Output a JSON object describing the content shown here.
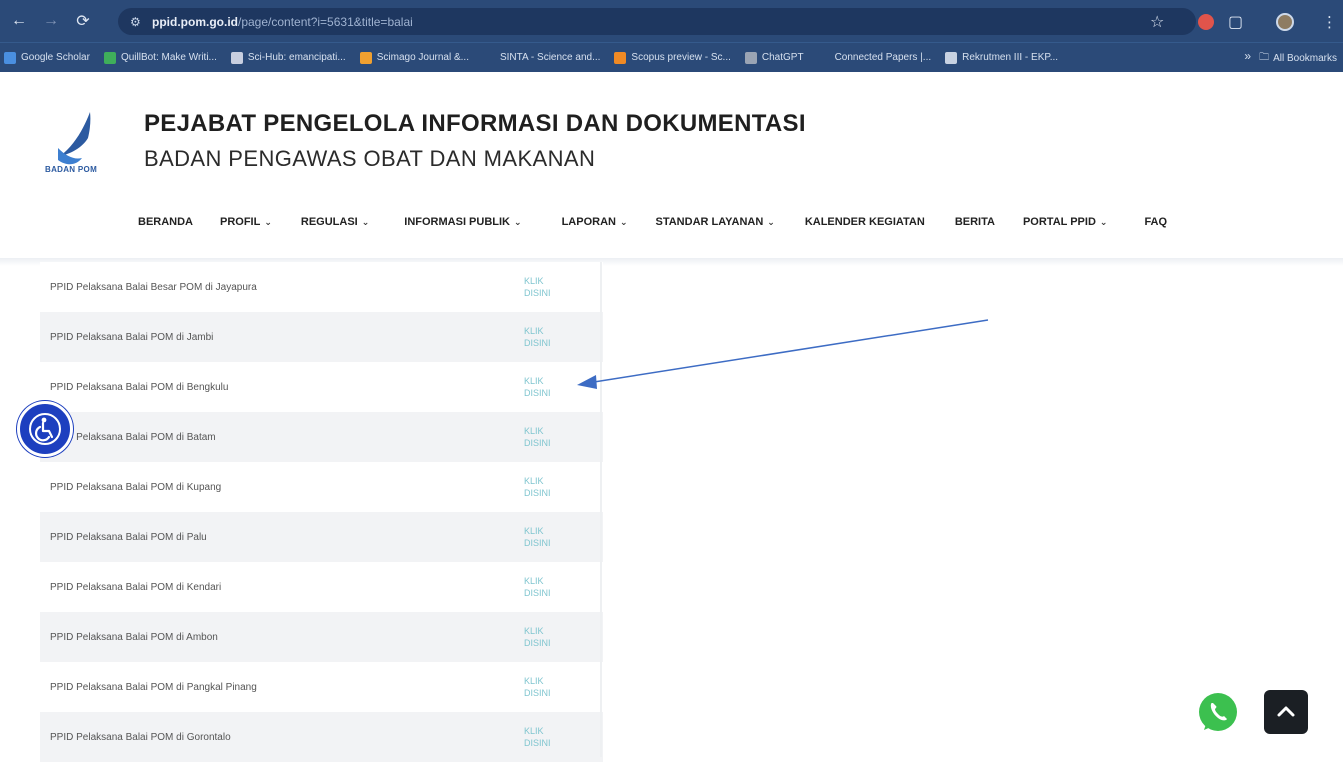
{
  "browser": {
    "url_host": "ppid.pom.go.id",
    "url_path": "/page/content?i=5631&title=balai",
    "bookmarks": [
      {
        "label": "Google Scholar",
        "color": "#4a8fe0"
      },
      {
        "label": "QuillBot: Make Writi...",
        "color": "#3fae5a"
      },
      {
        "label": "Sci-Hub: emancipati...",
        "color": "#c8cfe0"
      },
      {
        "label": "Scimago Journal &...",
        "color": "#f0a030"
      },
      {
        "label": "SINTA - Science and...",
        "color": "#2b4a78"
      },
      {
        "label": "Scopus preview - Sc...",
        "color": "#f08a24"
      },
      {
        "label": "ChatGPT",
        "color": "#9aa4b4"
      },
      {
        "label": "Connected Papers |...",
        "color": "#2b4a78"
      },
      {
        "label": "Rekrutmen III - EKP...",
        "color": "#c8d2e2"
      }
    ],
    "overflow_label": "»",
    "all_bookmarks": "All Bookmarks"
  },
  "site": {
    "logo_text": "BADAN POM",
    "title": "PEJABAT PENGELOLA INFORMASI DAN DOKUMENTASI",
    "subtitle": "BADAN PENGAWAS OBAT DAN MAKANAN"
  },
  "nav": [
    {
      "label": "BERANDA",
      "dropdown": false
    },
    {
      "label": "PROFIL",
      "dropdown": true
    },
    {
      "label": "REGULASI",
      "dropdown": true
    },
    {
      "label": "INFORMASI PUBLIK",
      "dropdown": true
    },
    {
      "label": "LAPORAN",
      "dropdown": true
    },
    {
      "label": "STANDAR LAYANAN",
      "dropdown": true
    },
    {
      "label": "KALENDER KEGIATAN",
      "dropdown": false
    },
    {
      "label": "BERITA",
      "dropdown": false
    },
    {
      "label": "PORTAL PPID",
      "dropdown": true
    },
    {
      "label": "FAQ",
      "dropdown": false
    }
  ],
  "nav_caret": "⌄",
  "rows": [
    {
      "name": "PPID Pelaksana Balai Besar POM di Jayapura",
      "link": "KLIK DISINI"
    },
    {
      "name": "PPID Pelaksana Balai POM di Jambi",
      "link": "KLIK DISINI"
    },
    {
      "name": "PPID Pelaksana Balai POM di Bengkulu",
      "link": "KLIK DISINI"
    },
    {
      "name": "PPID Pelaksana Balai POM di Batam",
      "link": "KLIK DISINI"
    },
    {
      "name": "PPID Pelaksana Balai POM di Kupang",
      "link": "KLIK DISINI"
    },
    {
      "name": "PPID Pelaksana Balai POM di Palu",
      "link": "KLIK DISINI"
    },
    {
      "name": "PPID Pelaksana Balai POM di Kendari",
      "link": "KLIK DISINI"
    },
    {
      "name": "PPID Pelaksana Balai POM di Ambon",
      "link": "KLIK DISINI"
    },
    {
      "name": "PPID Pelaksana Balai POM di Pangkal Pinang",
      "link": "KLIK DISINI"
    },
    {
      "name": "PPID Pelaksana Balai POM di Gorontalo",
      "link": "KLIK DISINI"
    }
  ],
  "colors": {
    "chrome": "#2b4a78",
    "link": "#7fc5cf",
    "annotation_arrow": "#3d6cc4",
    "accessibility": "#1d3fbf",
    "whatsapp": "#3cc04f"
  }
}
